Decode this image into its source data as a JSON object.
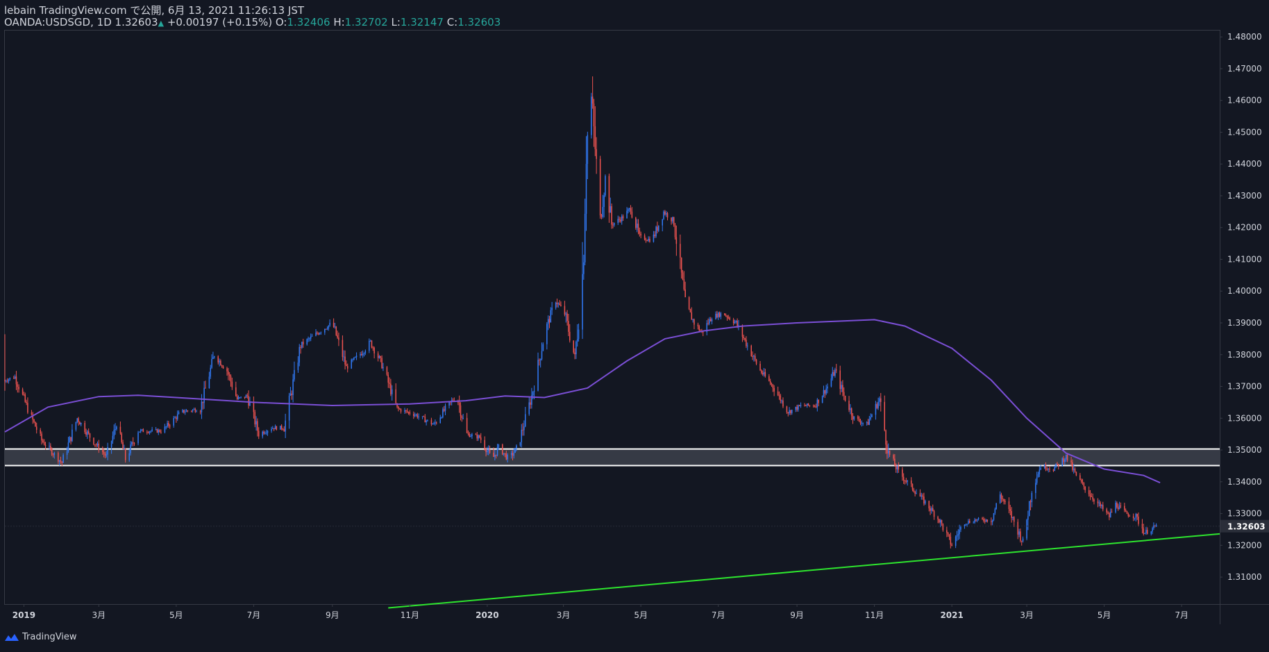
{
  "header": {
    "publisher_line": "lebain TradingView.com で公開, 6月 13, 2021 11:26:13 JST",
    "symbol": "OANDA:USDSGD, 1D",
    "last": "1.32603",
    "change": "+0.00197 (+0.15%)",
    "o_label": "O:",
    "o_value": "1.32406",
    "h_label": "H:",
    "h_value": "1.32702",
    "l_label": "L:",
    "l_value": "1.32147",
    "c_label": "C:",
    "c_value": "1.32603"
  },
  "footer": {
    "brand": "TradingView"
  },
  "colors": {
    "background": "#131722",
    "up": "#3179f5",
    "down": "#ef5350",
    "ma": "#7b4fd6",
    "trendline": "#2ee62e",
    "zone_fill": "#363a45",
    "zone_border": "#ffffff",
    "axis_text": "#d1d4dc",
    "header_values": "#26a69a"
  },
  "chart_data": {
    "type": "candlestick",
    "symbol": "OANDA:USDSGD",
    "interval": "1D",
    "ylim": [
      1.3015,
      1.482
    ],
    "y_ticks": [
      "1.48000",
      "1.47000",
      "1.46000",
      "1.45000",
      "1.44000",
      "1.43000",
      "1.42000",
      "1.41000",
      "1.40000",
      "1.39000",
      "1.38000",
      "1.37000",
      "1.36000",
      "1.35000",
      "1.34000",
      "1.33000",
      "1.32000",
      "1.31000"
    ],
    "y_tick_values": [
      1.48,
      1.47,
      1.46,
      1.45,
      1.44,
      1.43,
      1.42,
      1.41,
      1.4,
      1.39,
      1.38,
      1.37,
      1.36,
      1.35,
      1.34,
      1.33,
      1.32,
      1.31
    ],
    "last_price_label": "1.32603",
    "last_price": 1.32603,
    "x_range": [
      "2018-12-17",
      "2021-07-31"
    ],
    "x_ticks": [
      {
        "label": "2019",
        "date": "2019-01-01"
      },
      {
        "label": "3月",
        "date": "2019-03-01"
      },
      {
        "label": "5月",
        "date": "2019-05-01"
      },
      {
        "label": "7月",
        "date": "2019-07-01"
      },
      {
        "label": "9月",
        "date": "2019-09-01"
      },
      {
        "label": "11月",
        "date": "2019-11-01"
      },
      {
        "label": "2020",
        "date": "2020-01-01"
      },
      {
        "label": "3月",
        "date": "2020-03-01"
      },
      {
        "label": "5月",
        "date": "2020-05-01"
      },
      {
        "label": "7月",
        "date": "2020-07-01"
      },
      {
        "label": "9月",
        "date": "2020-09-01"
      },
      {
        "label": "11月",
        "date": "2020-11-01"
      },
      {
        "label": "2021",
        "date": "2021-01-01"
      },
      {
        "label": "3月",
        "date": "2021-03-01"
      },
      {
        "label": "5月",
        "date": "2021-05-01"
      },
      {
        "label": "7月",
        "date": "2021-07-01"
      }
    ],
    "price_path": [
      [
        "2018-12-17",
        1.372
      ],
      [
        "2018-12-25",
        1.373
      ],
      [
        "2019-01-05",
        1.362
      ],
      [
        "2019-01-15",
        1.353
      ],
      [
        "2019-01-31",
        1.346
      ],
      [
        "2019-02-12",
        1.36
      ],
      [
        "2019-02-24",
        1.353
      ],
      [
        "2019-03-07",
        1.348
      ],
      [
        "2019-03-15",
        1.358
      ],
      [
        "2019-03-22",
        1.347
      ],
      [
        "2019-04-01",
        1.356
      ],
      [
        "2019-04-20",
        1.356
      ],
      [
        "2019-05-05",
        1.362
      ],
      [
        "2019-05-20",
        1.363
      ],
      [
        "2019-05-31",
        1.38
      ],
      [
        "2019-06-10",
        1.375
      ],
      [
        "2019-06-18",
        1.366
      ],
      [
        "2019-06-26",
        1.367
      ],
      [
        "2019-07-05",
        1.355
      ],
      [
        "2019-07-15",
        1.357
      ],
      [
        "2019-07-25",
        1.357
      ],
      [
        "2019-08-07",
        1.383
      ],
      [
        "2019-08-21",
        1.387
      ],
      [
        "2019-09-01",
        1.39
      ],
      [
        "2019-09-12",
        1.376
      ],
      [
        "2019-09-25",
        1.381
      ],
      [
        "2019-10-01",
        1.384
      ],
      [
        "2019-10-10",
        1.377
      ],
      [
        "2019-10-22",
        1.363
      ],
      [
        "2019-11-06",
        1.361
      ],
      [
        "2019-11-20",
        1.358
      ],
      [
        "2019-12-01",
        1.364
      ],
      [
        "2019-12-08",
        1.367
      ],
      [
        "2019-12-16",
        1.355
      ],
      [
        "2019-12-26",
        1.354
      ],
      [
        "2020-01-05",
        1.347
      ],
      [
        "2020-01-10",
        1.351
      ],
      [
        "2020-01-18",
        1.347
      ],
      [
        "2020-01-25",
        1.351
      ],
      [
        "2020-02-05",
        1.367
      ],
      [
        "2020-02-16",
        1.388
      ],
      [
        "2020-02-24",
        1.397
      ],
      [
        "2020-03-02",
        1.393
      ],
      [
        "2020-03-10",
        1.379
      ],
      [
        "2020-03-16",
        1.405
      ],
      [
        "2020-03-19",
        1.445
      ],
      [
        "2020-03-23",
        1.461
      ],
      [
        "2020-03-26",
        1.445
      ],
      [
        "2020-03-30",
        1.423
      ],
      [
        "2020-04-03",
        1.436
      ],
      [
        "2020-04-08",
        1.421
      ],
      [
        "2020-04-16",
        1.423
      ],
      [
        "2020-04-23",
        1.426
      ],
      [
        "2020-04-30",
        1.417
      ],
      [
        "2020-05-10",
        1.416
      ],
      [
        "2020-05-19",
        1.425
      ],
      [
        "2020-05-27",
        1.422
      ],
      [
        "2020-06-05",
        1.396
      ],
      [
        "2020-06-12",
        1.39
      ],
      [
        "2020-06-18",
        1.387
      ],
      [
        "2020-06-26",
        1.392
      ],
      [
        "2020-07-05",
        1.393
      ],
      [
        "2020-07-15",
        1.39
      ],
      [
        "2020-07-25",
        1.382
      ],
      [
        "2020-08-03",
        1.375
      ],
      [
        "2020-08-13",
        1.37
      ],
      [
        "2020-08-25",
        1.362
      ],
      [
        "2020-09-05",
        1.364
      ],
      [
        "2020-09-15",
        1.364
      ],
      [
        "2020-09-25",
        1.37
      ],
      [
        "2020-10-01",
        1.375
      ],
      [
        "2020-10-08",
        1.367
      ],
      [
        "2020-10-16",
        1.36
      ],
      [
        "2020-10-26",
        1.358
      ],
      [
        "2020-11-05",
        1.366
      ],
      [
        "2020-11-12",
        1.349
      ],
      [
        "2020-11-20",
        1.343
      ],
      [
        "2020-12-01",
        1.338
      ],
      [
        "2020-12-12",
        1.333
      ],
      [
        "2020-12-22",
        1.328
      ],
      [
        "2021-01-01",
        1.32
      ],
      [
        "2021-01-10",
        1.327
      ],
      [
        "2021-01-20",
        1.328
      ],
      [
        "2021-02-01",
        1.328
      ],
      [
        "2021-02-08",
        1.336
      ],
      [
        "2021-02-16",
        1.33
      ],
      [
        "2021-02-26",
        1.321
      ],
      [
        "2021-03-05",
        1.338
      ],
      [
        "2021-03-12",
        1.345
      ],
      [
        "2021-03-22",
        1.344
      ],
      [
        "2021-04-01",
        1.348
      ],
      [
        "2021-04-10",
        1.341
      ],
      [
        "2021-04-22",
        1.335
      ],
      [
        "2021-05-05",
        1.329
      ],
      [
        "2021-05-10",
        1.333
      ],
      [
        "2021-05-18",
        1.33
      ],
      [
        "2021-05-26",
        1.329
      ],
      [
        "2021-06-02",
        1.324
      ],
      [
        "2021-06-07",
        1.325
      ],
      [
        "2021-06-11",
        1.326
      ]
    ],
    "moving_average": [
      [
        "2018-12-17",
        1.3557
      ],
      [
        "2019-01-20",
        1.3635
      ],
      [
        "2019-03-01",
        1.3668
      ],
      [
        "2019-04-01",
        1.3672
      ],
      [
        "2019-05-01",
        1.3665
      ],
      [
        "2019-07-01",
        1.365
      ],
      [
        "2019-09-01",
        1.364
      ],
      [
        "2019-11-01",
        1.3645
      ],
      [
        "2019-12-15",
        1.3655
      ],
      [
        "2020-01-15",
        1.367
      ],
      [
        "2020-02-15",
        1.3665
      ],
      [
        "2020-03-20",
        1.3695
      ],
      [
        "2020-04-20",
        1.378
      ],
      [
        "2020-05-20",
        1.385
      ],
      [
        "2020-06-20",
        1.3875
      ],
      [
        "2020-07-20",
        1.389
      ],
      [
        "2020-09-01",
        1.39
      ],
      [
        "2020-10-01",
        1.3905
      ],
      [
        "2020-11-01",
        1.391
      ],
      [
        "2020-11-25",
        1.389
      ],
      [
        "2021-01-01",
        1.382
      ],
      [
        "2021-02-01",
        1.372
      ],
      [
        "2021-03-01",
        1.36
      ],
      [
        "2021-04-01",
        1.349
      ],
      [
        "2021-05-01",
        1.344
      ],
      [
        "2021-06-01",
        1.342
      ],
      [
        "2021-06-14",
        1.3397
      ]
    ],
    "zone": {
      "upper": 1.3503,
      "lower": 1.3451
    },
    "trendline": {
      "from": [
        "2019-10-15",
        1.3003
      ],
      "to": [
        "2021-07-31",
        1.3236
      ]
    }
  }
}
